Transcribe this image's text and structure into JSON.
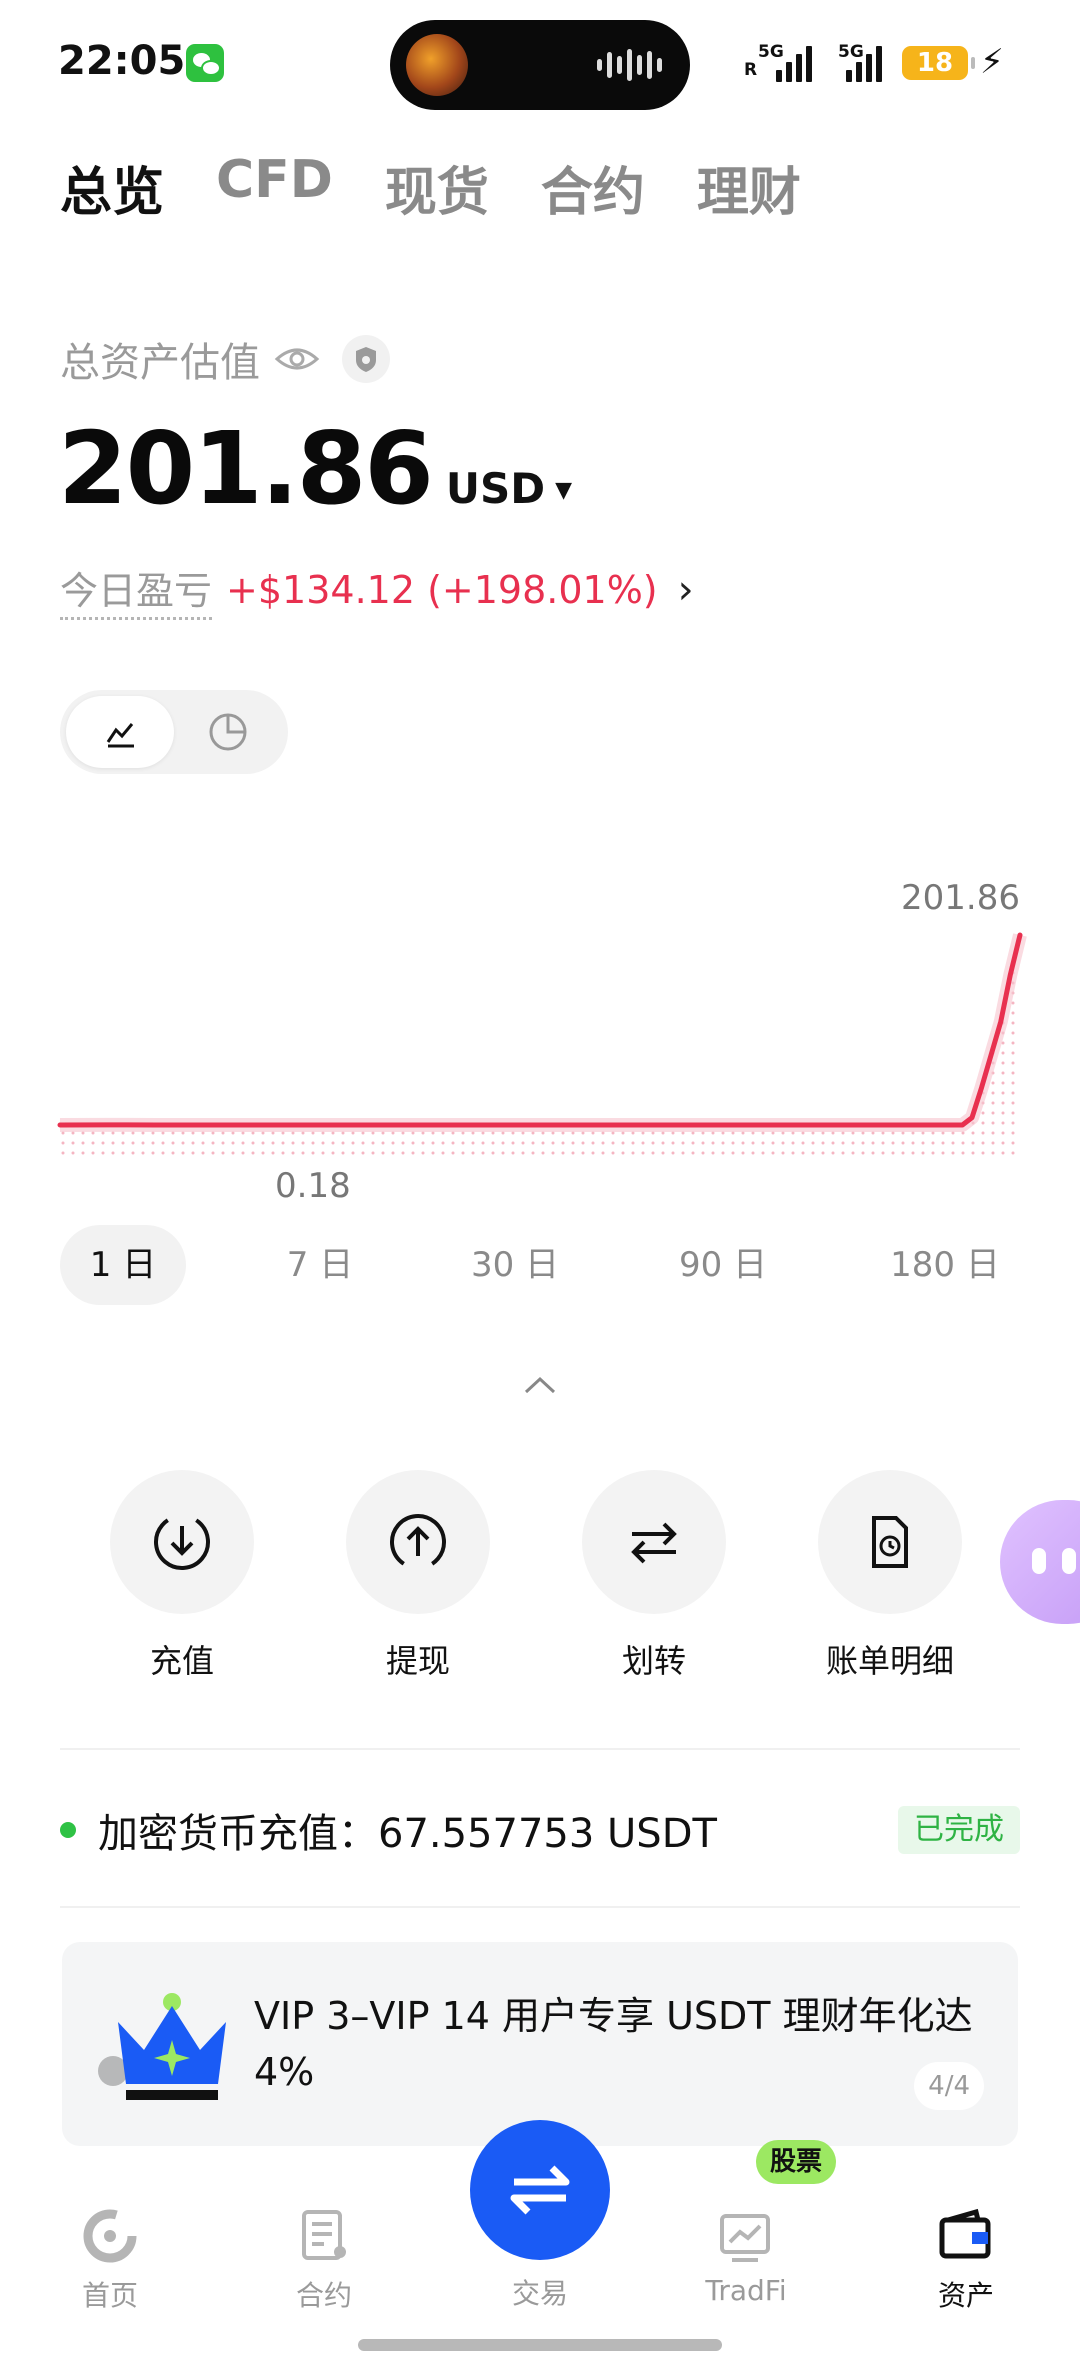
{
  "status_bar": {
    "time": "22:05",
    "signal1_label": "5G",
    "signal1_sub": "R",
    "signal2_label": "5G",
    "battery": "18"
  },
  "top_tabs": [
    {
      "label": "总览",
      "active": true
    },
    {
      "label": "CFD",
      "active": false
    },
    {
      "label": "现货",
      "active": false
    },
    {
      "label": "合约",
      "active": false
    },
    {
      "label": "理财",
      "active": false
    }
  ],
  "overview": {
    "estimate_label": "总资产估值",
    "amount": "201.86",
    "currency": "USD",
    "pnl_label": "今日盈亏",
    "pnl_value": "+$134.12 (+198.01%)"
  },
  "chart_toggle": {
    "options": [
      "line-chart-icon",
      "pie-chart-icon"
    ],
    "active": 0
  },
  "chart_data": {
    "type": "line",
    "max_label": "201.86",
    "min_label": "0.18",
    "color": "#e8304f",
    "x": [
      0,
      5,
      10,
      15,
      20,
      25,
      30,
      35,
      40,
      45,
      50,
      55,
      60,
      65,
      70,
      75,
      80,
      85,
      90,
      92,
      94,
      95,
      96,
      97,
      98,
      99,
      100
    ],
    "values": [
      0.18,
      0.3,
      0.18,
      0.2,
      0.18,
      0.18,
      0.18,
      0.18,
      0.18,
      0.18,
      0.18,
      0.18,
      0.18,
      0.18,
      0.18,
      0.18,
      0.18,
      0.18,
      0.18,
      0.18,
      0.18,
      8,
      40,
      75,
      110,
      160,
      201.86
    ]
  },
  "range_tabs": [
    {
      "label": "1 日",
      "active": true
    },
    {
      "label": "7 日",
      "active": false
    },
    {
      "label": "30 日",
      "active": false
    },
    {
      "label": "90 日",
      "active": false
    },
    {
      "label": "180 日",
      "active": false
    }
  ],
  "actions": [
    {
      "label": "充值",
      "icon": "deposit-icon"
    },
    {
      "label": "提现",
      "icon": "withdraw-icon"
    },
    {
      "label": "划转",
      "icon": "transfer-icon"
    },
    {
      "label": "账单明细",
      "icon": "bill-icon"
    }
  ],
  "deposit_notice": {
    "text": "加密货币充值：67.557753 USDT",
    "status": "已完成"
  },
  "promo": {
    "text": "VIP 3–VIP 14 用户专享 USDT 理财年化达 4%",
    "page": "4/4"
  },
  "bottom_nav": {
    "items": [
      {
        "label": "首页",
        "icon": "home-icon",
        "active": false
      },
      {
        "label": "合约",
        "icon": "contract-icon",
        "active": false
      },
      {
        "label": "交易",
        "icon": "trade-icon",
        "active": false
      },
      {
        "label": "TradFi",
        "icon": "tradfi-icon",
        "active": false
      },
      {
        "label": "资产",
        "icon": "wallet-icon",
        "active": true
      }
    ],
    "badge": "股票"
  }
}
